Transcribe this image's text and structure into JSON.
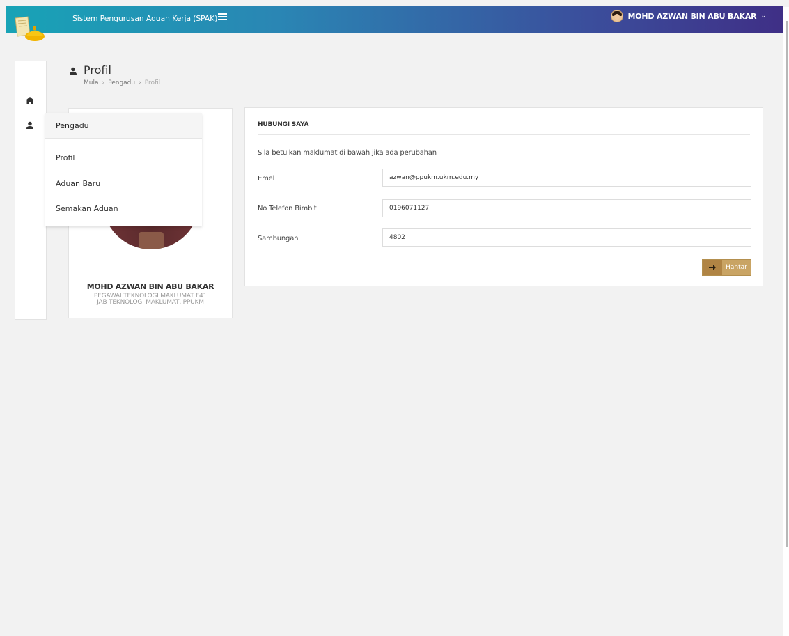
{
  "header": {
    "app_title": "Sistem Pengurusan Aduan Kerja (SPAK)",
    "user_name": "MOHD AZWAN BIN ABU BAKAR"
  },
  "page": {
    "title": "Profil",
    "breadcrumb": [
      "Mula",
      "Pengadu",
      "Profil"
    ]
  },
  "flyout": {
    "heading": "Pengadu",
    "items": [
      "Profil",
      "Aduan Baru",
      "Semakan Aduan"
    ]
  },
  "profile": {
    "name": "MOHD AZWAN BIN ABU BAKAR",
    "position": "PEGAWAI TEKNOLOGI MAKLUMAT F41",
    "department": "JAB TEKNOLOGI MAKLUMAT, PPUKM"
  },
  "contact_form": {
    "title": "HUBUNGI SAYA",
    "intro": "Sila betulkan maklumat di bawah jika ada perubahan",
    "fields": [
      {
        "label": "Emel",
        "value": "azwan@ppukm.ukm.edu.my"
      },
      {
        "label": "No Telefon Bimbit",
        "value": "0196071127"
      },
      {
        "label": "Sambungan",
        "value": "4802"
      }
    ],
    "submit_label": "Hantar"
  },
  "colors": {
    "header_gradient_start": "#18a3b6",
    "header_gradient_end": "#3f2f86",
    "submit_button": "#c9a464"
  }
}
